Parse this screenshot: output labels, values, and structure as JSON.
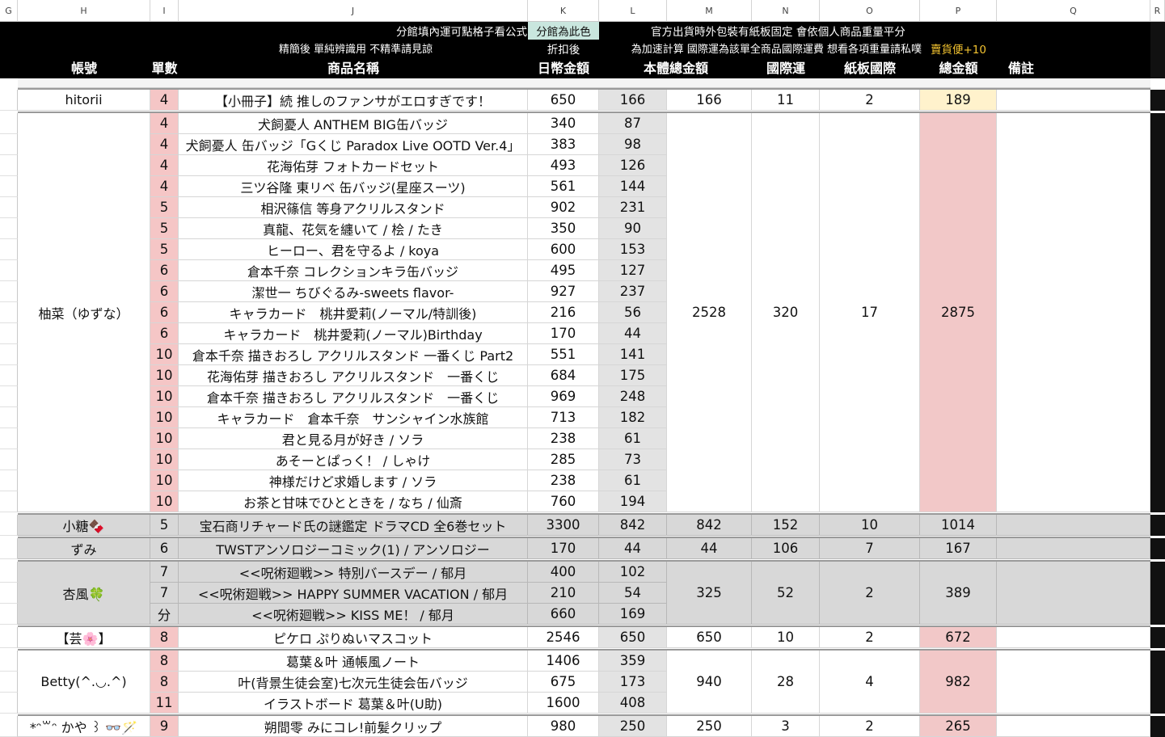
{
  "column_letters": [
    "G",
    "H",
    "I",
    "J",
    "K",
    "L",
    "M",
    "N",
    "O",
    "P",
    "Q",
    "R"
  ],
  "header": {
    "note_left": "分館填內運可點格子看公式",
    "note_tag": "分館為此色",
    "note_right": "官方出貨時外包裝有紙板固定 會依個人商品重量平分",
    "note2_left": "精簡後 單純辨識用 不精準請見諒",
    "note2_mid": "折扣後",
    "note2_right": "為加速計算 國際運為該單全商品國際運費 想看各項重量請私噗",
    "note2_bonus": "賣貨便+10",
    "col_account": "帳號",
    "col_qty": "單數",
    "col_name": "商品名稱",
    "col_jpy": "日幣金額",
    "col_subtotal": "本體總金額",
    "col_intl": "國際運",
    "col_board": "紙板國際",
    "col_total": "總金額",
    "col_note": "備註"
  },
  "colors": {
    "qty_bg": "#f5c6c6",
    "total_pink": "#f2c8c8",
    "total_yellow": "#fff2cc",
    "disc_bg": "#e3e3e3",
    "group_gray": "#d8d8d8",
    "note_tag_bg": "#c9e6de",
    "bonus_color": "#f4c430"
  },
  "groups": [
    {
      "account": "hitorii",
      "bg": "white",
      "total_style": "yellow",
      "sep": "top",
      "subtotal": "166",
      "intl": "11",
      "board": "2",
      "total": "189",
      "items": [
        {
          "qty": "4",
          "name": "【小冊子】続 推しのファンサがエロすぎです！",
          "jpy": "650",
          "disc": "166"
        }
      ]
    },
    {
      "account": "柚菜（ゆずな）",
      "bg": "white",
      "total_style": "pink",
      "sep": "top",
      "subtotal": "2528",
      "intl": "320",
      "board": "17",
      "total": "2875",
      "items": [
        {
          "qty": "4",
          "name": "犬飼憂人 ANTHEM BIG缶バッジ",
          "jpy": "340",
          "disc": "87"
        },
        {
          "qty": "4",
          "name": "犬飼憂人 缶バッジ「Gくじ Paradox Live OOTD Ver.4」",
          "jpy": "383",
          "disc": "98"
        },
        {
          "qty": "4",
          "name": "花海佑芽 フォトカードセット",
          "jpy": "493",
          "disc": "126"
        },
        {
          "qty": "4",
          "name": "三ツ谷隆 東リベ 缶バッジ(星座スーツ)",
          "jpy": "561",
          "disc": "144"
        },
        {
          "qty": "5",
          "name": "相沢篠信 等身アクリルスタンド",
          "jpy": "902",
          "disc": "231"
        },
        {
          "qty": "5",
          "name": "真龍、花気を纏いて / 桧 / たき",
          "jpy": "350",
          "disc": "90"
        },
        {
          "qty": "5",
          "name": "ヒーロー、君を守るよ / koya",
          "jpy": "600",
          "disc": "153"
        },
        {
          "qty": "6",
          "name": "倉本千奈 コレクションキラ缶バッジ",
          "jpy": "495",
          "disc": "127"
        },
        {
          "qty": "6",
          "name": "潔世一 ちびぐるみ-sweets flavor-",
          "jpy": "927",
          "disc": "237"
        },
        {
          "qty": "6",
          "name": "キャラカード　桃井愛莉(ノーマル/特訓後)",
          "jpy": "216",
          "disc": "56"
        },
        {
          "qty": "6",
          "name": "キャラカード　桃井愛莉(ノーマル)Birthday",
          "jpy": "170",
          "disc": "44"
        },
        {
          "qty": "10",
          "name": "倉本千奈 描きおろし アクリルスタンド 一番くじ Part2",
          "jpy": "551",
          "disc": "141"
        },
        {
          "qty": "10",
          "name": "花海佑芽 描きおろし アクリルスタンド　一番くじ",
          "jpy": "684",
          "disc": "175"
        },
        {
          "qty": "10",
          "name": "倉本千奈 描きおろし アクリルスタンド　一番くじ",
          "jpy": "969",
          "disc": "248"
        },
        {
          "qty": "10",
          "name": "キャラカード　倉本千奈　サンシャイン水族館",
          "jpy": "713",
          "disc": "182"
        },
        {
          "qty": "10",
          "name": "君と見る月が好き / ソラ",
          "jpy": "238",
          "disc": "61"
        },
        {
          "qty": "10",
          "name": "あそーとぱっく！ / しゃけ",
          "jpy": "285",
          "disc": "73"
        },
        {
          "qty": "10",
          "name": "神様だけど求婚します / ソラ",
          "jpy": "238",
          "disc": "61"
        },
        {
          "qty": "10",
          "name": "お茶と甘味でひとときを / なち / 仙斎",
          "jpy": "760",
          "disc": "194"
        }
      ]
    },
    {
      "account": "小糖🍫",
      "bg": "gray",
      "total_style": "gray",
      "sep": "top",
      "subtotal": "842",
      "intl": "152",
      "board": "10",
      "total": "1014",
      "items": [
        {
          "qty": "5",
          "name": "宝石商リチャード氏の謎鑑定 ドラマCD 全6巻セット",
          "jpy": "3300",
          "disc": "842"
        }
      ]
    },
    {
      "account": "ずみ",
      "bg": "gray",
      "total_style": "gray",
      "sep": "top",
      "subtotal": "44",
      "intl": "106",
      "board": "7",
      "total": "167",
      "items": [
        {
          "qty": "6",
          "name": "TWSTアンソロジーコミック(1) / アンソロジー",
          "jpy": "170",
          "disc": "44"
        }
      ]
    },
    {
      "account": "杏風🍀",
      "bg": "gray",
      "total_style": "gray",
      "sep": "top",
      "subtotal": "325",
      "intl": "52",
      "board": "2",
      "total": "389",
      "items": [
        {
          "qty": "7",
          "name": "<<呪術廻戦>> 特別バースデー / 郁月",
          "jpy": "400",
          "disc": "102"
        },
        {
          "qty": "7",
          "name": "<<呪術廻戦>> HAPPY SUMMER VACATION / 郁月",
          "jpy": "210",
          "disc": "54"
        },
        {
          "qty": "分",
          "name": "<<呪術廻戦>> KISS ME！ / 郁月",
          "jpy": "660",
          "disc": "169"
        }
      ]
    },
    {
      "account": "【芸🌸】",
      "bg": "white",
      "total_style": "pink",
      "sep": "top",
      "subtotal": "650",
      "intl": "10",
      "board": "2",
      "total": "672",
      "items": [
        {
          "qty": "8",
          "name": "ピケロ ぷりぬいマスコット",
          "jpy": "2546",
          "disc": "650"
        }
      ]
    },
    {
      "account": "Betty(^.◡.^)",
      "bg": "white",
      "total_style": "pink",
      "sep": "top",
      "subtotal": "940",
      "intl": "28",
      "board": "4",
      "total": "982",
      "items": [
        {
          "qty": "8",
          "name": "葛葉＆叶 通帳風ノート",
          "jpy": "1406",
          "disc": "359"
        },
        {
          "qty": "8",
          "name": "叶(背景生徒会室)七次元生徒会缶バッジ",
          "jpy": "675",
          "disc": "173"
        },
        {
          "qty": "11",
          "name": "イラストボード 葛葉＆叶(U助)",
          "jpy": "1600",
          "disc": "408"
        }
      ]
    },
    {
      "account": "*ᵔ꒳ᵔ かや ꒱ 👓🪄",
      "bg": "white",
      "total_style": "pink",
      "sep": "top",
      "subtotal": "250",
      "intl": "3",
      "board": "2",
      "total": "265",
      "items": [
        {
          "qty": "9",
          "name": "朔間零 みにコレ!前髪クリップ",
          "jpy": "980",
          "disc": "250"
        }
      ]
    }
  ]
}
